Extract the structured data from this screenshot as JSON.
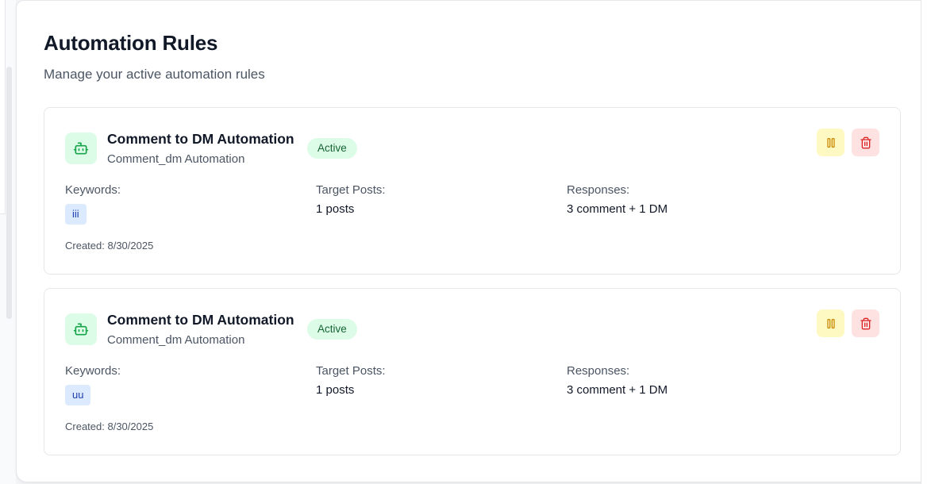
{
  "header": {
    "title": "Automation Rules",
    "subtitle": "Manage your active automation rules"
  },
  "rules": [
    {
      "title": "Comment to DM Automation",
      "type": "Comment_dm Automation",
      "status": "Active",
      "keywords_label": "Keywords:",
      "keywords": [
        "iii"
      ],
      "target_label": "Target Posts:",
      "target_value": "1 posts",
      "responses_label": "Responses:",
      "responses_value": "3 comment + 1 DM",
      "created": "Created: 8/30/2025"
    },
    {
      "title": "Comment to DM Automation",
      "type": "Comment_dm Automation",
      "status": "Active",
      "keywords_label": "Keywords:",
      "keywords": [
        "uu"
      ],
      "target_label": "Target Posts:",
      "target_value": "1 posts",
      "responses_label": "Responses:",
      "responses_value": "3 comment + 1 DM",
      "created": "Created: 8/30/2025"
    }
  ],
  "icons": {
    "rule_icon": "bot-icon",
    "pause_icon": "pause-icon",
    "delete_icon": "trash-icon"
  },
  "colors": {
    "active_badge_bg": "#dcfce7",
    "active_badge_text": "#166534",
    "pause_bg": "#fef9c3",
    "pause_fg": "#ca8a04",
    "delete_bg": "#fee2e2",
    "delete_fg": "#dc2626",
    "keyword_bg": "#dbeafe",
    "keyword_text": "#1e40af"
  }
}
